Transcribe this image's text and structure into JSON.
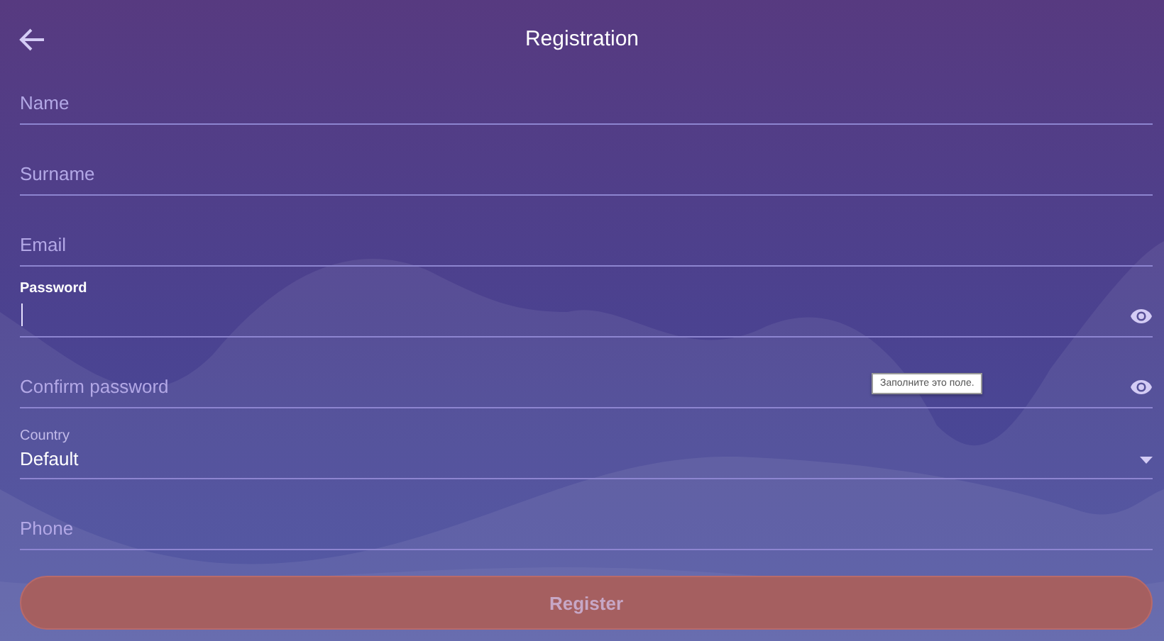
{
  "header": {
    "title": "Registration"
  },
  "fields": [
    {
      "kind": "text",
      "placeholder": "Name",
      "focused": false
    },
    {
      "kind": "text",
      "placeholder": "Surname",
      "focused": false
    },
    {
      "kind": "text",
      "placeholder": "Email",
      "focused": false
    },
    {
      "kind": "password",
      "label": "Password",
      "focused": true
    },
    {
      "kind": "password",
      "placeholder": "Confirm password",
      "focused": false,
      "tooltip": "Заполните это поле."
    },
    {
      "kind": "select",
      "label": "Country",
      "value": "Default",
      "focused": false
    },
    {
      "kind": "text",
      "placeholder": "Phone",
      "focused": false
    }
  ],
  "button": {
    "label": "Register"
  }
}
